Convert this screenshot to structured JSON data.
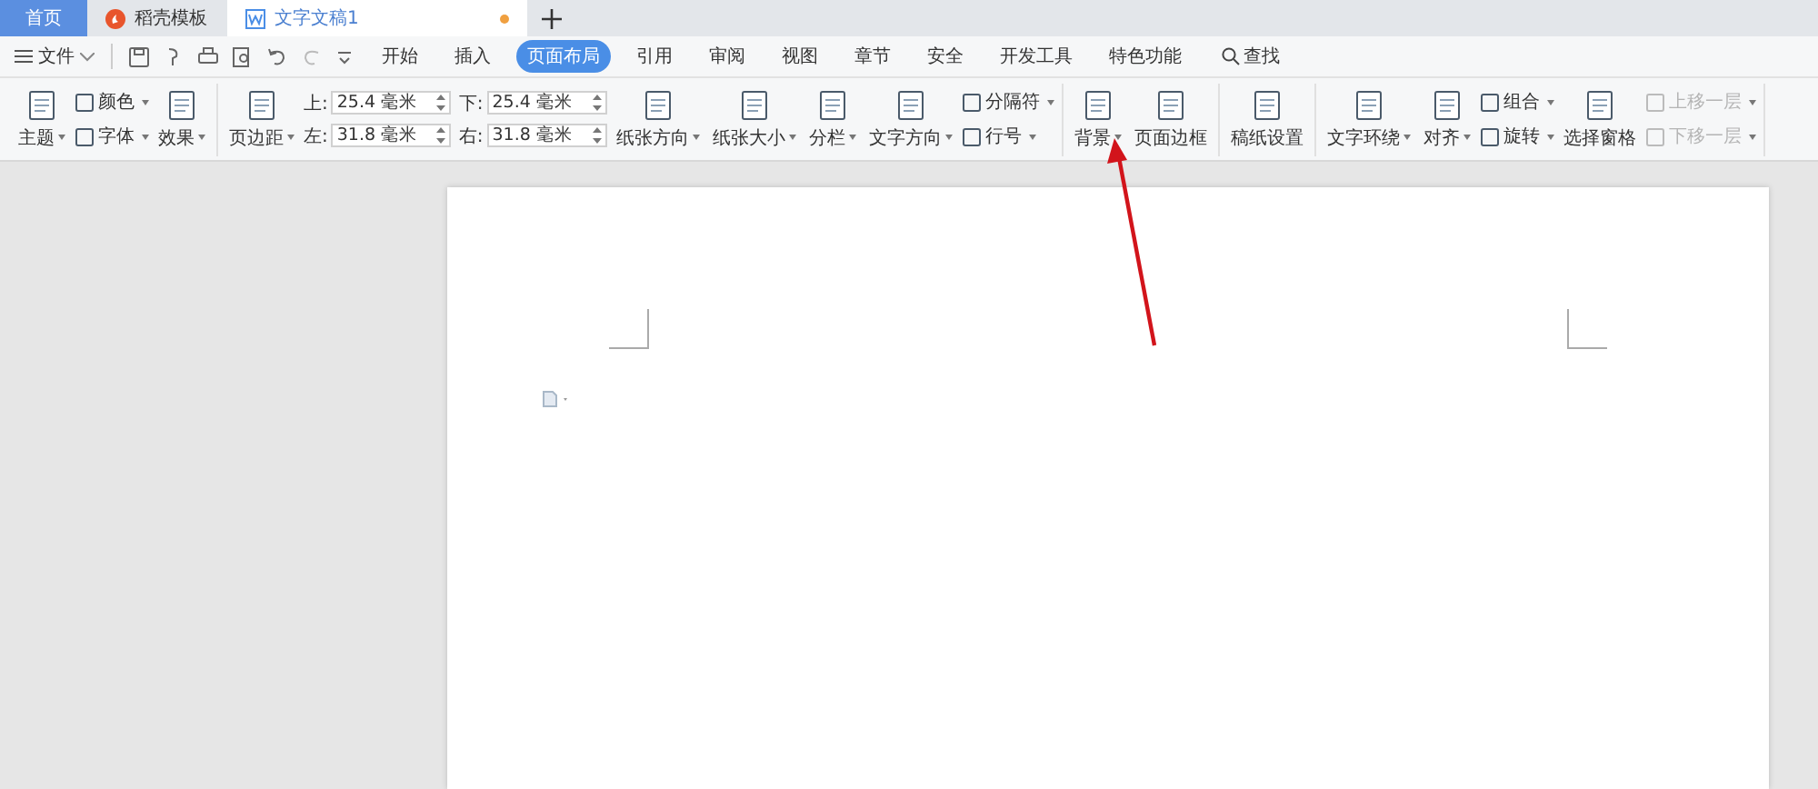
{
  "tabs": [
    {
      "label": "首页",
      "kind": "home",
      "selected": false
    },
    {
      "label": "稻壳模板",
      "kind": "docer",
      "selected": false
    },
    {
      "label": "文字文稿1",
      "kind": "doc",
      "selected": true,
      "modified": true
    }
  ],
  "menu": {
    "file": "文件",
    "tabs": [
      {
        "label": "开始",
        "selected": false
      },
      {
        "label": "插入",
        "selected": false
      },
      {
        "label": "页面布局",
        "selected": true
      },
      {
        "label": "引用",
        "selected": false
      },
      {
        "label": "审阅",
        "selected": false
      },
      {
        "label": "视图",
        "selected": false
      },
      {
        "label": "章节",
        "selected": false
      },
      {
        "label": "安全",
        "selected": false
      },
      {
        "label": "开发工具",
        "selected": false
      },
      {
        "label": "特色功能",
        "selected": false
      }
    ],
    "search": "查找"
  },
  "ribbon": [
    {
      "items": [
        {
          "kind": "large",
          "label": "主题",
          "dropdown": true
        },
        {
          "kind": "stack",
          "rows": [
            {
              "label": "颜色",
              "dropdown": true,
              "disabled": false
            },
            {
              "label": "字体",
              "dropdown": true,
              "disabled": false
            }
          ]
        },
        {
          "kind": "large",
          "label": "效果",
          "dropdown": true
        }
      ]
    },
    {
      "items": [
        {
          "kind": "large",
          "label": "页边距",
          "dropdown": true
        },
        {
          "kind": "margins",
          "fields": [
            {
              "label": "上:",
              "value": "25.4 毫米"
            },
            {
              "label": "下:",
              "value": "25.4 毫米"
            },
            {
              "label": "左:",
              "value": "31.8 毫米"
            },
            {
              "label": "右:",
              "value": "31.8 毫米"
            }
          ]
        },
        {
          "kind": "large",
          "label": "纸张方向",
          "dropdown": true
        },
        {
          "kind": "large",
          "label": "纸张大小",
          "dropdown": true
        },
        {
          "kind": "large",
          "label": "分栏",
          "dropdown": true
        },
        {
          "kind": "large",
          "label": "文字方向",
          "dropdown": true
        },
        {
          "kind": "stack",
          "rows": [
            {
              "label": "分隔符",
              "dropdown": true,
              "disabled": false
            },
            {
              "label": "行号",
              "dropdown": true,
              "disabled": false
            }
          ]
        }
      ]
    },
    {
      "items": [
        {
          "kind": "large",
          "label": "背景",
          "dropdown": true
        },
        {
          "kind": "large",
          "label": "页面边框",
          "dropdown": false
        }
      ]
    },
    {
      "items": [
        {
          "kind": "large",
          "label": "稿纸设置",
          "dropdown": false
        }
      ]
    },
    {
      "items": [
        {
          "kind": "large",
          "label": "文字环绕",
          "dropdown": true
        },
        {
          "kind": "large",
          "label": "对齐",
          "dropdown": true
        },
        {
          "kind": "stack",
          "rows": [
            {
              "label": "组合",
              "dropdown": true,
              "disabled": false
            },
            {
              "label": "旋转",
              "dropdown": true,
              "disabled": false
            }
          ]
        },
        {
          "kind": "large",
          "label": "选择窗格",
          "dropdown": false
        },
        {
          "kind": "stack",
          "rows": [
            {
              "label": "上移一层",
              "dropdown": true,
              "disabled": true
            },
            {
              "label": "下移一层",
              "dropdown": true,
              "disabled": true
            }
          ]
        }
      ]
    }
  ]
}
